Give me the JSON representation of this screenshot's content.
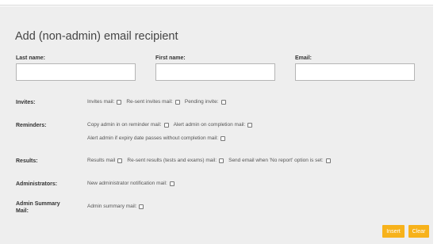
{
  "title": "Add (non-admin) email recipient",
  "fields": {
    "last_name_label": "Last name:",
    "first_name_label": "First name:",
    "email_label": "Email:",
    "last_name_value": "",
    "first_name_value": "",
    "email_value": ""
  },
  "rows": {
    "invites": {
      "label": "Invites:",
      "options": [
        "Invites mail:",
        "Re-sent invites mail:",
        "Pending invite:"
      ]
    },
    "reminders": {
      "label": "Reminders:",
      "options": [
        "Copy admin in on reminder mail:",
        "Alert admin on completion mail:"
      ],
      "options2": [
        "Alert admin if expiry date passes without completion mail:"
      ]
    },
    "results": {
      "label": "Results:",
      "options": [
        "Results mail",
        "Re-sent results (tests and exams) mail:",
        "Send email when 'No report' option is set:"
      ]
    },
    "administrators": {
      "label": "Administrators:",
      "options": [
        "New administrator notification mail:"
      ]
    },
    "admin_summary": {
      "label": "Admin Summary Mail:",
      "options": [
        "Admin summary mail:"
      ]
    }
  },
  "buttons": {
    "insert": "Insert",
    "clear": "Clear"
  },
  "colors": {
    "button": "#f7b21b",
    "panel": "#eeeeee"
  }
}
